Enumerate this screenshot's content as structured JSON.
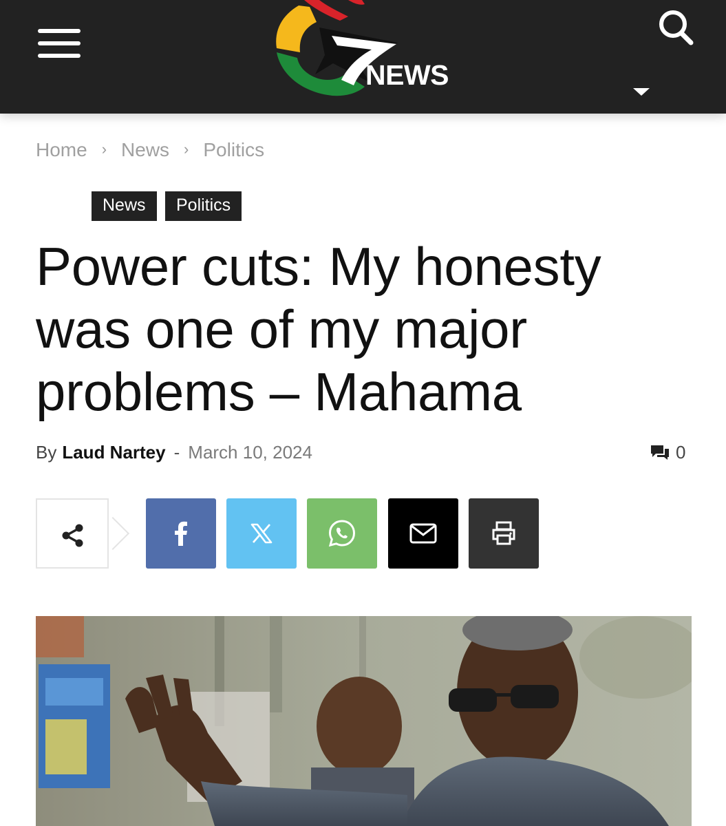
{
  "header": {
    "logo_text": "NEWS",
    "logo_colors": {
      "red": "#d8232a",
      "yellow": "#f5b81c",
      "green": "#1e8b3a",
      "black": "#111111"
    }
  },
  "breadcrumb": {
    "items": [
      "Home",
      "News",
      "Politics"
    ],
    "separator": "›"
  },
  "tags": [
    "News",
    "Politics"
  ],
  "article": {
    "title_lines": [
      "Power cuts: My honesty",
      "was one of my major",
      "problems – Mahama"
    ],
    "by_label": "By",
    "author": "Laud Nartey",
    "dash": "-",
    "date": "March 10, 2024",
    "comment_count": "0"
  },
  "share": {
    "buttons": [
      "share",
      "facebook",
      "x",
      "whatsapp",
      "email",
      "print"
    ],
    "colors": {
      "facebook": "#516eab",
      "x": "#62c2f2",
      "whatsapp": "#7bbf6a",
      "email": "#000000",
      "print": "#333333"
    }
  }
}
